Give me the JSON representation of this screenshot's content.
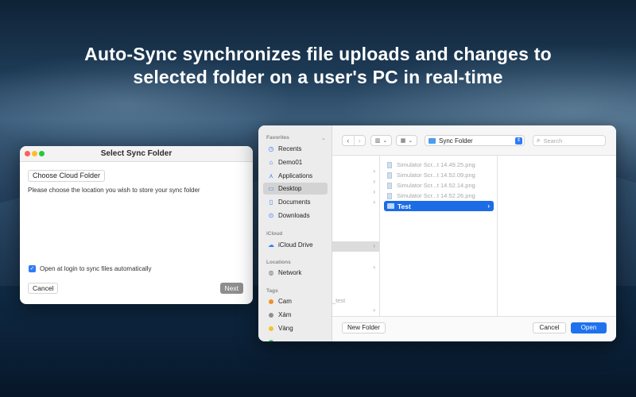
{
  "headline": {
    "line1": "Auto-Sync synchronizes file uploads and changes to",
    "line2": "selected folder on a user's PC in real-time"
  },
  "sync_dialog": {
    "title": "Select Sync Folder",
    "choose_button": "Choose Cloud Folder",
    "help_text": "Please choose the location you wish to store your sync folder",
    "checkbox_label": "Open at login to sync files automatically",
    "checkbox_checked": true,
    "cancel_button": "Cancel",
    "next_button": "Next"
  },
  "finder": {
    "sidebar": {
      "favorites_title": "Favorites",
      "favorites": [
        {
          "label": "Recents",
          "icon": "clock-icon"
        },
        {
          "label": "Demo01",
          "icon": "home-icon"
        },
        {
          "label": "Applications",
          "icon": "applications-icon"
        },
        {
          "label": "Desktop",
          "icon": "desktop-icon",
          "selected": true
        },
        {
          "label": "Documents",
          "icon": "document-icon"
        },
        {
          "label": "Downloads",
          "icon": "download-icon"
        }
      ],
      "icloud_title": "iCloud",
      "icloud": [
        {
          "label": "iCloud Drive",
          "icon": "cloud-icon"
        }
      ],
      "locations_title": "Locations",
      "locations": [
        {
          "label": "Network",
          "icon": "globe-icon"
        }
      ],
      "tags_title": "Tags",
      "tags": [
        {
          "label": "Cam",
          "color": "#f0902a"
        },
        {
          "label": "Xám",
          "color": "#8e8e93"
        },
        {
          "label": "Vàng",
          "color": "#f5c22c"
        }
      ]
    },
    "toolbar": {
      "path_label": "Sync Folder",
      "search_placeholder": "Search"
    },
    "column1_partial_text": "_test",
    "files": [
      "Simulator Scr...t 14.49.25.png",
      "Simulator Scr...t 14.52.09.png",
      "Simulator Scr...t 14.52.14.png",
      "Simulator Scr...t 14.52.26.png"
    ],
    "selected_folder": "Test",
    "new_folder_button": "New Folder",
    "cancel_button": "Cancel",
    "open_button": "Open"
  }
}
